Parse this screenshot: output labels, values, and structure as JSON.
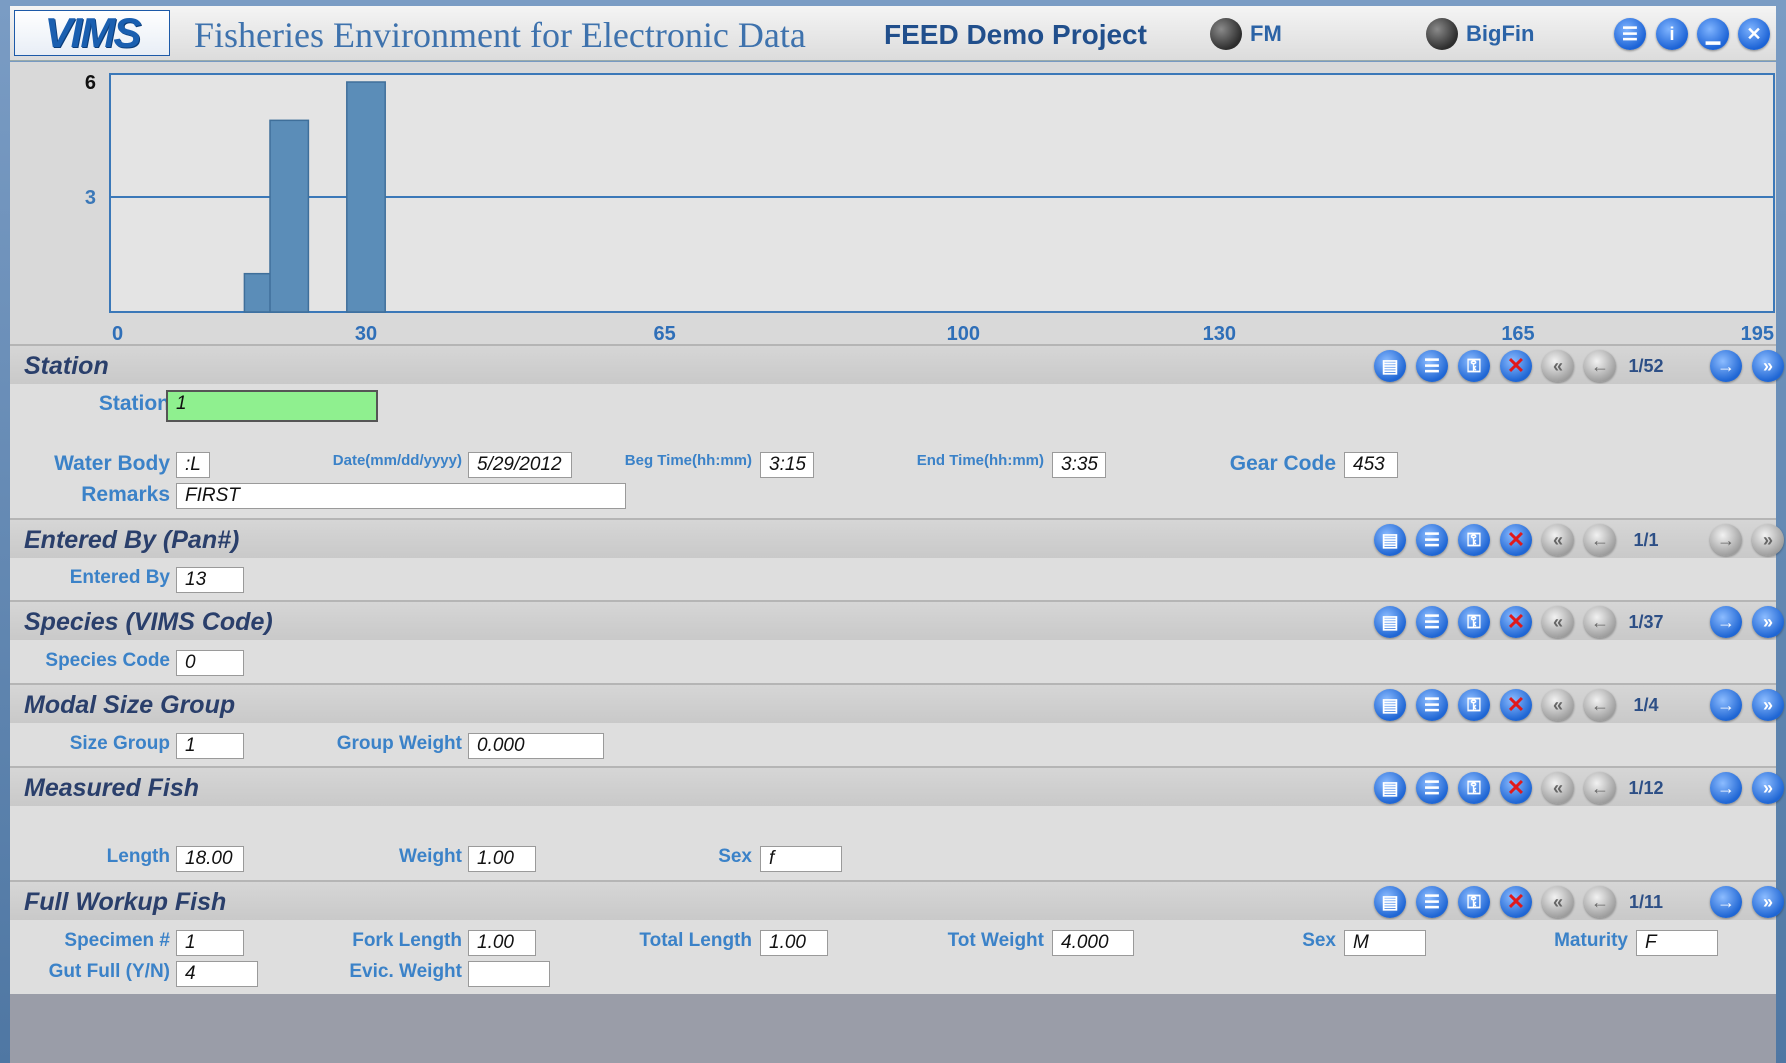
{
  "header": {
    "logo_text": "VIMS",
    "app_title": "Fisheries Environment for Electronic Data",
    "project_title": "FEED Demo Project",
    "radio_fm": "FM",
    "radio_bigfin": "BigFin",
    "icons": [
      "list-icon",
      "info-icon",
      "minimize-icon",
      "close-icon"
    ]
  },
  "chart_data": {
    "type": "bar",
    "x_ticks": [
      0,
      30,
      65,
      100,
      130,
      165,
      195
    ],
    "y_ticks": [
      3,
      6
    ],
    "xlim": [
      0,
      195
    ],
    "ylim": [
      0,
      6
    ],
    "bars": [
      {
        "x": 18,
        "value": 1
      },
      {
        "x": 21,
        "value": 5
      },
      {
        "x": 30,
        "value": 6
      }
    ],
    "bar_color": "#5b8db8",
    "grid_color": "#3b78b8"
  },
  "sections": {
    "station": {
      "title": "Station",
      "counter": "1/52",
      "station_label": "Station",
      "station_value": "1",
      "water_body_label": "Water Body",
      "water_body_value": ":L",
      "date_label": "Date(mm/dd/yyyy)",
      "date_value": "5/29/2012",
      "beg_time_label": "Beg Time(hh:mm)",
      "beg_time_value": "3:15",
      "end_time_label": "End Time(hh:mm)",
      "end_time_value": "3:35",
      "gear_code_label": "Gear Code",
      "gear_code_value": "453",
      "remarks_label": "Remarks",
      "remarks_value": "FIRST"
    },
    "entered_by": {
      "title": "Entered By (Pan#)",
      "counter": "1/1",
      "entered_by_label": "Entered By",
      "entered_by_value": "13"
    },
    "species": {
      "title": "Species (VIMS Code)",
      "counter": "1/37",
      "species_code_label": "Species Code",
      "species_code_value": "0"
    },
    "modal_size": {
      "title": "Modal Size Group",
      "counter": "1/4",
      "size_group_label": "Size Group",
      "size_group_value": "1",
      "group_weight_label": "Group Weight",
      "group_weight_value": "0.000"
    },
    "measured_fish": {
      "title": "Measured Fish",
      "counter": "1/12",
      "length_label": "Length",
      "length_value": "18.00",
      "weight_label": "Weight",
      "weight_value": "1.00",
      "sex_label": "Sex",
      "sex_value": "f"
    },
    "full_workup": {
      "title": "Full Workup Fish",
      "counter": "1/11",
      "specimen_label": "Specimen #",
      "specimen_value": "1",
      "fork_length_label": "Fork Length",
      "fork_length_value": "1.00",
      "total_length_label": "Total Length",
      "total_length_value": "1.00",
      "tot_weight_label": "Tot Weight",
      "tot_weight_value": "4.000",
      "sex_label": "Sex",
      "sex_value": "M",
      "maturity_label": "Maturity",
      "maturity_value": "F",
      "gut_full_label": "Gut Full (Y/N)",
      "gut_full_value": "4",
      "evic_weight_label": "Evic. Weight",
      "evic_weight_value": ""
    }
  }
}
